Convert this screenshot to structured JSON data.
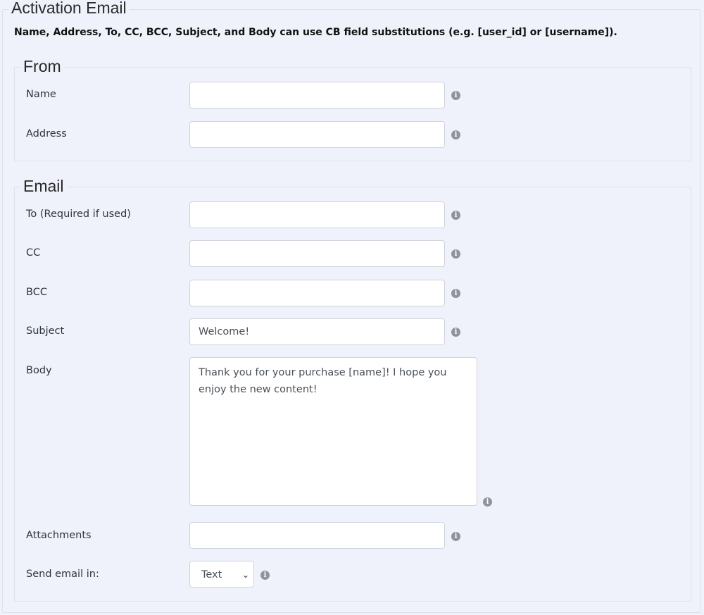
{
  "title": "Activation Email",
  "note": "Name, Address, To, CC, BCC, Subject, and Body can use CB field substitutions (e.g. [user_id] or [username]).",
  "from": {
    "legend": "From",
    "name_label": "Name",
    "name_value": "",
    "address_label": "Address",
    "address_value": ""
  },
  "email": {
    "legend": "Email",
    "to_label": "To (Required if used)",
    "to_value": "",
    "cc_label": "CC",
    "cc_value": "",
    "bcc_label": "BCC",
    "bcc_value": "",
    "subject_label": "Subject",
    "subject_value": "Welcome!",
    "body_label": "Body",
    "body_value": "Thank you for your purchase [name]! I hope you enjoy the new content!",
    "attachments_label": "Attachments",
    "attachments_value": "",
    "send_in_label": "Send email in:",
    "send_in_value": "Text"
  },
  "info_icon": "i"
}
